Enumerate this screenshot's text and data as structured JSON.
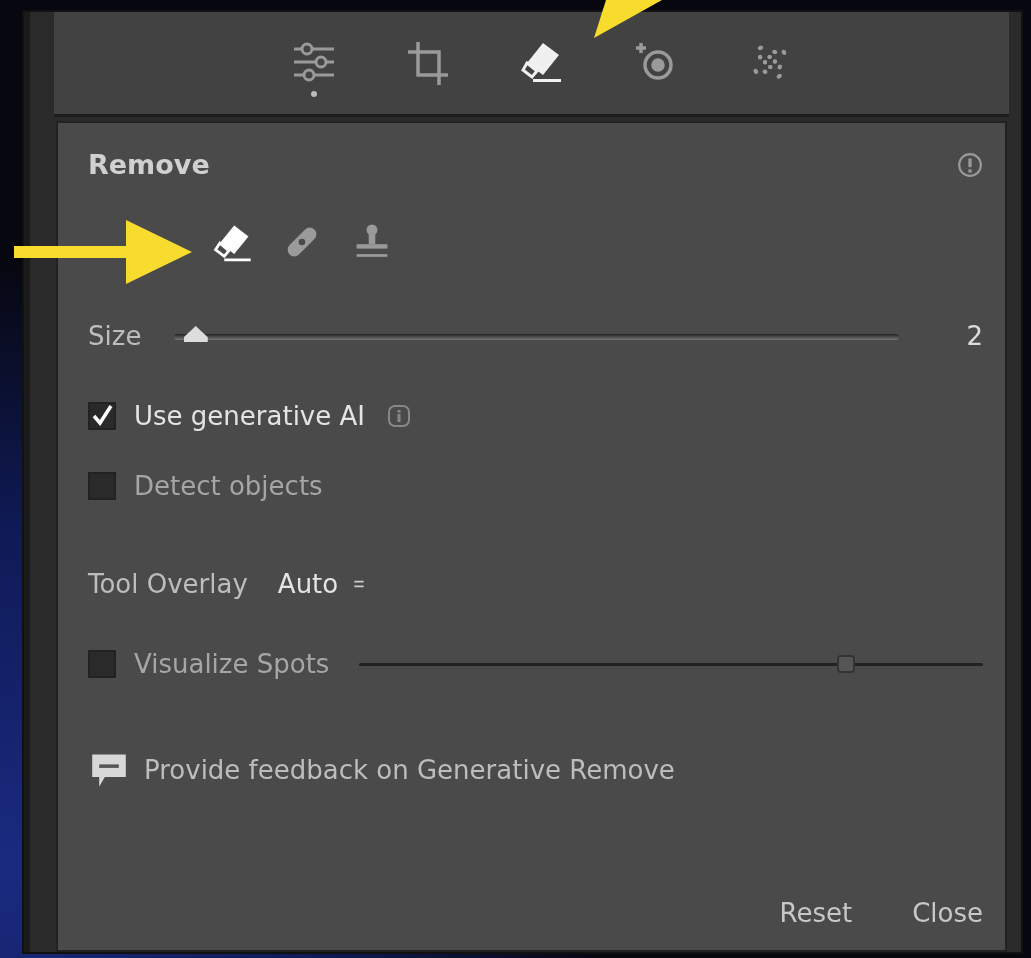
{
  "toolbar": {
    "tools": [
      {
        "kind": "edit",
        "selected": false,
        "dot": true
      },
      {
        "kind": "crop",
        "selected": false,
        "dot": false
      },
      {
        "kind": "remove",
        "selected": true,
        "dot": false
      },
      {
        "kind": "redeye",
        "selected": false,
        "dot": false
      },
      {
        "kind": "masking",
        "selected": false,
        "dot": false
      }
    ]
  },
  "panel": {
    "title": "Remove",
    "mode": {
      "options": [
        {
          "kind": "remove",
          "selected": true
        },
        {
          "kind": "heal",
          "selected": false
        },
        {
          "kind": "clone",
          "selected": false
        }
      ]
    },
    "size": {
      "label": "Size",
      "level": 0.03,
      "reading": "2"
    },
    "checkboxes": [
      {
        "label": "Use generative AI",
        "checked": true,
        "info": true
      },
      {
        "label": "Detect objects",
        "checked": false,
        "info": false
      }
    ],
    "tool_overlay": {
      "label": "Tool Overlay",
      "value": "Auto"
    },
    "visualize_spots": {
      "label": "Visualize Spots",
      "checked": false,
      "level": 0.78
    },
    "feedback": "Provide feedback on Generative Remove",
    "buttons": [
      "Reset",
      "Close"
    ]
  }
}
